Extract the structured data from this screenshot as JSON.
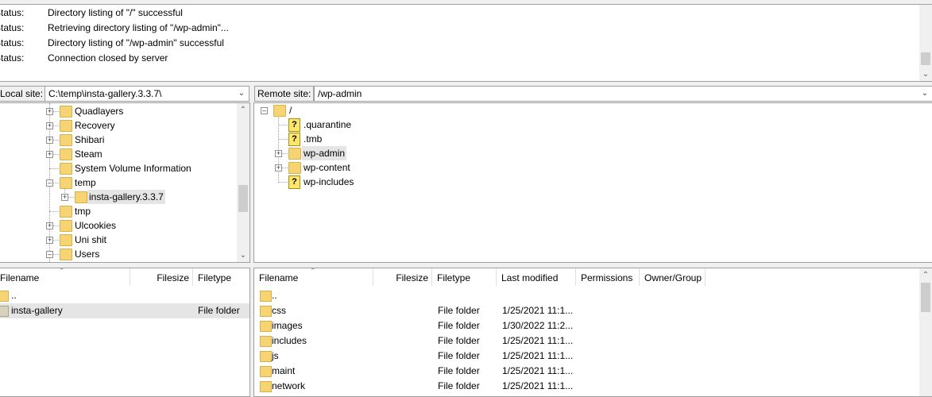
{
  "log": {
    "lines": [
      {
        "label": "Status:",
        "message": "Directory listing of \"/\" successful"
      },
      {
        "label": "Status:",
        "message": "Retrieving directory listing of \"/wp-admin\"..."
      },
      {
        "label": "Status:",
        "message": "Directory listing of \"/wp-admin\" successful"
      },
      {
        "label": "Status:",
        "message": "Connection closed by server"
      }
    ]
  },
  "local": {
    "site_label": "Local site:",
    "path": "C:\\temp\\insta-gallery.3.3.7\\",
    "tree": [
      {
        "label": "Quadlayers",
        "level": 1,
        "expander": "+"
      },
      {
        "label": "Recovery",
        "level": 1,
        "expander": "+"
      },
      {
        "label": "Shibari",
        "level": 1,
        "expander": "+"
      },
      {
        "label": "Steam",
        "level": 1,
        "expander": "+"
      },
      {
        "label": "System Volume Information",
        "level": 1,
        "expander": ""
      },
      {
        "label": "temp",
        "level": 1,
        "expander": "-"
      },
      {
        "label": "insta-gallery.3.3.7",
        "level": 2,
        "expander": "+",
        "selected": true
      },
      {
        "label": "tmp",
        "level": 1,
        "expander": ""
      },
      {
        "label": "Ulcookies",
        "level": 1,
        "expander": "+"
      },
      {
        "label": "Uni shit",
        "level": 1,
        "expander": "+"
      },
      {
        "label": "Users",
        "level": 1,
        "expander": "-"
      }
    ],
    "columns": [
      "Filename",
      "Filesize",
      "Filetype"
    ],
    "files": [
      {
        "name": "..",
        "size": "",
        "type": "",
        "icon": "folder"
      },
      {
        "name": "insta-gallery",
        "size": "",
        "type": "File folder",
        "icon": "folder-grey",
        "selected": true
      }
    ]
  },
  "remote": {
    "site_label": "Remote site:",
    "path": "/wp-admin",
    "tree": [
      {
        "label": "/",
        "level": 0,
        "expander": "-",
        "icon": "folder"
      },
      {
        "label": ".quarantine",
        "level": 1,
        "expander": "",
        "icon": "unknown"
      },
      {
        "label": ".tmb",
        "level": 1,
        "expander": "",
        "icon": "unknown"
      },
      {
        "label": "wp-admin",
        "level": 1,
        "expander": "+",
        "icon": "folder",
        "selected": true
      },
      {
        "label": "wp-content",
        "level": 1,
        "expander": "+",
        "icon": "folder"
      },
      {
        "label": "wp-includes",
        "level": 1,
        "expander": "",
        "icon": "unknown"
      }
    ],
    "columns": [
      "Filename",
      "Filesize",
      "Filetype",
      "Last modified",
      "Permissions",
      "Owner/Group"
    ],
    "files": [
      {
        "name": "..",
        "type": "",
        "modified": ""
      },
      {
        "name": "css",
        "type": "File folder",
        "modified": "1/25/2021 11:1..."
      },
      {
        "name": "images",
        "type": "File folder",
        "modified": "1/30/2022 11:2..."
      },
      {
        "name": "includes",
        "type": "File folder",
        "modified": "1/25/2021 11:1..."
      },
      {
        "name": "js",
        "type": "File folder",
        "modified": "1/25/2021 11:1..."
      },
      {
        "name": "maint",
        "type": "File folder",
        "modified": "1/25/2021 11:1..."
      },
      {
        "name": "network",
        "type": "File folder",
        "modified": "1/25/2021 11:1..."
      }
    ]
  },
  "colors": {
    "folder": "#f6d474",
    "selection": "#e5e5e5",
    "border": "#a0a0a0"
  }
}
